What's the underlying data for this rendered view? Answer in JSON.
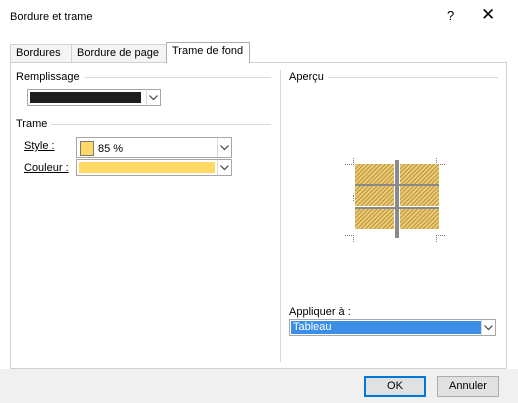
{
  "dialog": {
    "title": "Bordure et trame",
    "help": "?",
    "close": "✕"
  },
  "tabs": [
    {
      "label": "Bordures",
      "accesskey_index": 0
    },
    {
      "label": "Bordure de page",
      "accesskey_index": 13
    },
    {
      "label": "Trame de fond",
      "accesskey_index": 0
    }
  ],
  "remplissage": {
    "heading": "Remplissage",
    "color": "#1e1e1e"
  },
  "trame": {
    "heading": "Trame",
    "style_label": "Style :",
    "style_value": "85 %",
    "style_swatch": "#ffd966",
    "couleur_label": "Couleur :",
    "couleur_color": "#ffd966"
  },
  "apercu": {
    "heading": "Aperçu"
  },
  "appliquer": {
    "label": "Appliquer à :",
    "value": "Tableau",
    "highlight": "#3c8fe7"
  },
  "buttons": {
    "ok": "OK",
    "cancel": "Annuler"
  }
}
